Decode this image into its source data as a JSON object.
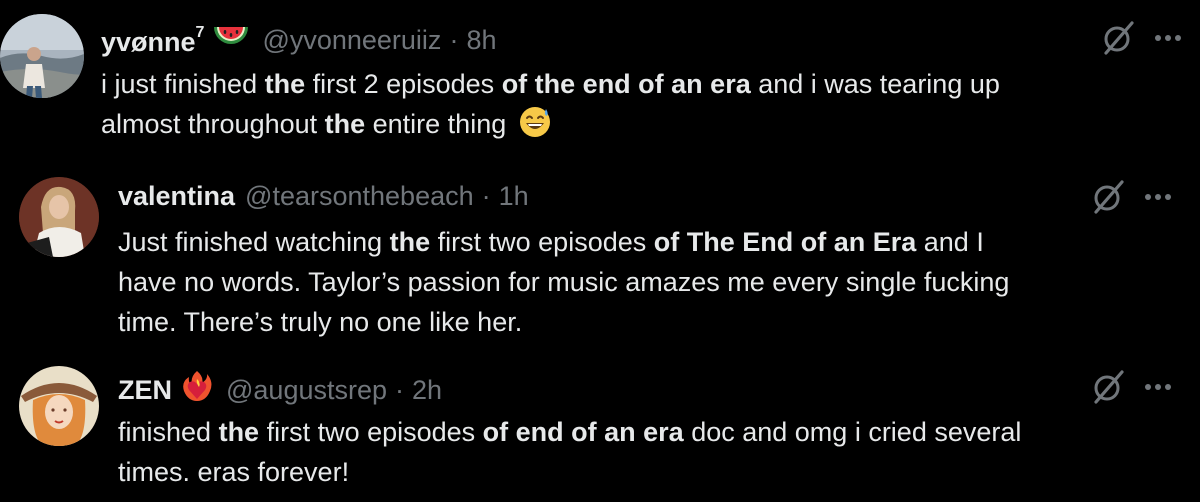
{
  "colors": {
    "background": "#000000",
    "text_primary": "#e7e9ea",
    "text_secondary": "#71767b"
  },
  "tweets": [
    {
      "name": "yvønne",
      "name_sup": "7",
      "badge_icon": "watermelon-icon",
      "handle": "@yvonneeruiiz",
      "dot": "·",
      "time": "8h",
      "line1": [
        {
          "t": "i just finished ",
          "b": false
        },
        {
          "t": "the",
          "b": true
        },
        {
          "t": " first 2 episodes ",
          "b": false
        },
        {
          "t": "of the end of an era",
          "b": true
        },
        {
          "t": " and i was tearing up",
          "b": false
        }
      ],
      "line2": [
        {
          "t": "almost throughout ",
          "b": false
        },
        {
          "t": "the",
          "b": true
        },
        {
          "t": " entire thing",
          "b": false
        }
      ],
      "trailing_emoji": "grinning-sweat-emoji"
    },
    {
      "name": "valentina",
      "handle": "@tearsonthebeach",
      "dot": "·",
      "time": "1h",
      "line1": [
        {
          "t": "Just finished watching ",
          "b": false
        },
        {
          "t": "the",
          "b": true
        },
        {
          "t": " first two episodes ",
          "b": false
        },
        {
          "t": "of The End of an Era",
          "b": true
        },
        {
          "t": " and I",
          "b": false
        }
      ],
      "line2": [
        {
          "t": "have no words. Taylor’s passion for music amazes me every single fucking",
          "b": false
        }
      ],
      "line3": [
        {
          "t": "time. There’s truly no one like her.",
          "b": false
        }
      ]
    },
    {
      "name": "ZEN",
      "badge_icon": "fire-heart-icon",
      "handle": "@augustsrep",
      "dot": "·",
      "time": "2h",
      "line1": [
        {
          "t": "finished ",
          "b": false
        },
        {
          "t": "the",
          "b": true
        },
        {
          "t": " first two episodes ",
          "b": false
        },
        {
          "t": "of end of an era",
          "b": true
        },
        {
          "t": " doc and omg i cried several",
          "b": false
        }
      ],
      "line2": [
        {
          "t": "times. eras forever!",
          "b": false
        }
      ]
    }
  ]
}
